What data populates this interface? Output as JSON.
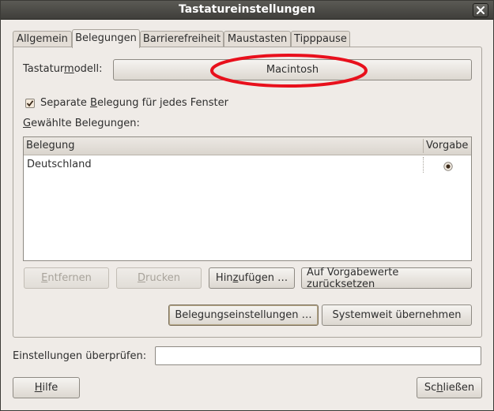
{
  "window": {
    "title": "Tastatureinstellungen"
  },
  "tabs": [
    {
      "label": "Allgemein",
      "active": false
    },
    {
      "label": "Belegungen",
      "active": true
    },
    {
      "label": "Barrierefreiheit",
      "active": false
    },
    {
      "label": "Maustasten",
      "active": false
    },
    {
      "label": "Tipppause",
      "active": false
    }
  ],
  "model": {
    "label_pre": "Tastatur",
    "label_mnemonic": "m",
    "label_post": "odell:",
    "value": "Macintosh"
  },
  "separate_layout": {
    "checked": true,
    "label_pre": "Separate ",
    "label_mnemonic": "B",
    "label_post": "elegung für jedes Fenster"
  },
  "selected_layouts": {
    "label_mnemonic": "G",
    "label_post": "ewählte Belegungen:",
    "columns": {
      "layout": "Belegung",
      "default": "Vorgabe"
    },
    "rows": [
      {
        "name": "Deutschland",
        "is_default": true
      }
    ]
  },
  "list_buttons": {
    "remove_mnemonic": "E",
    "remove_post": "ntfernen",
    "print_mnemonic": "D",
    "print_post": "rucken",
    "add_pre": "Hin",
    "add_mnemonic": "z",
    "add_post": "ufügen …",
    "reset_label": "Auf Vorgabewerte zurücksetzen"
  },
  "layout_options_label": "Belegungseinstellungen …",
  "apply_system_label": "Systemweit übernehmen",
  "test": {
    "label": "Einstellungen überprüfen:",
    "value": ""
  },
  "footer": {
    "help_mnemonic": "H",
    "help_post": "ilfe",
    "close_pre": "Sc",
    "close_mnemonic": "h",
    "close_post": "ließen"
  },
  "colors": {
    "annotation": "#e8101c",
    "radio": "#3b2a1a",
    "title_bar": "#4a4945"
  }
}
